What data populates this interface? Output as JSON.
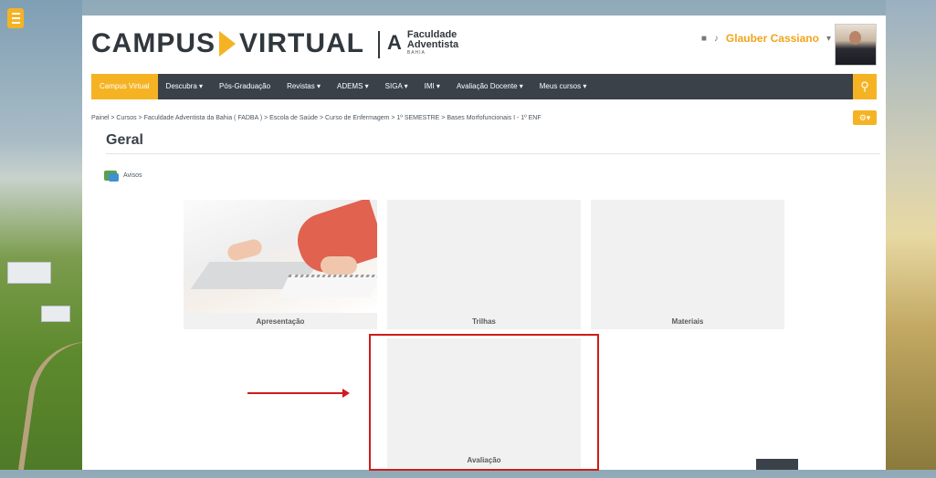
{
  "brand": {
    "logo_left": "CAMPUS",
    "logo_right": "VIRTUAL",
    "institution_line1": "Faculdade",
    "institution_line2": "Adventista",
    "institution_sub": "BAHIA"
  },
  "user": {
    "name": "Glauber Cassiano"
  },
  "nav": {
    "items": [
      {
        "label": "Campus Virtual"
      },
      {
        "label": "Descubra ▾"
      },
      {
        "label": "Pós-Graduação"
      },
      {
        "label": "Revistas ▾"
      },
      {
        "label": "ADEMS ▾"
      },
      {
        "label": "SIGA ▾"
      },
      {
        "label": "IMI ▾"
      },
      {
        "label": "Avaliação Docente ▾"
      },
      {
        "label": "Meus cursos ▾"
      }
    ]
  },
  "breadcrumb": "Painel > Cursos > Faculdade Adventista da Bahia ( FADBA ) > Escola de Saúde > Curso de Enfermagem > 1º SEMESTRE > Bases Morfofuncionais I - 1º ENF",
  "section": {
    "title": "Geral",
    "forum_label": "Avisos"
  },
  "tiles": [
    {
      "label": "Apresentação"
    },
    {
      "label": "Trilhas"
    },
    {
      "label": "Materiais"
    },
    {
      "label": "Avaliação"
    }
  ],
  "colors": {
    "accent": "#f5b324",
    "navbar": "#3a4149",
    "annotation": "#d01b1b"
  }
}
